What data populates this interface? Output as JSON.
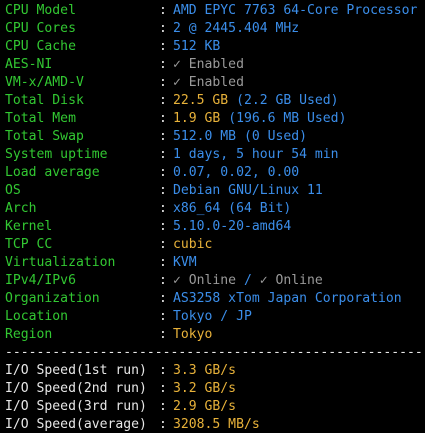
{
  "colors": {
    "background": "#000000",
    "label": "#32c832",
    "separator": "#e8e8e8",
    "value_blue": "#3b8eea",
    "value_gray": "#9a9a9a",
    "value_yellow": "#e8b23a"
  },
  "separator": ":",
  "system_info": [
    {
      "label": "CPU Model",
      "value": "AMD EPYC 7763 64-Core Processor"
    },
    {
      "label": "CPU Cores",
      "value": "2 @ 2445.404 MHz"
    },
    {
      "label": "CPU Cache",
      "value": "512 KB"
    },
    {
      "label": "AES-NI",
      "value": "✓ Enabled"
    },
    {
      "label": "VM-x/AMD-V",
      "value": "✓ Enabled"
    },
    {
      "label": "Total Disk",
      "value": "22.5 GB",
      "value_extra": "(2.2 GB Used)"
    },
    {
      "label": "Total Mem",
      "value": "1.9 GB",
      "value_extra": "(196.6 MB Used)"
    },
    {
      "label": "Total Swap",
      "value": "512.0 MB (0 Used)"
    },
    {
      "label": "System uptime",
      "value": "1 days, 5 hour 54 min"
    },
    {
      "label": "Load average",
      "value": "0.07, 0.02, 0.00"
    },
    {
      "label": "OS",
      "value": "Debian GNU/Linux 11"
    },
    {
      "label": "Arch",
      "value": "x86_64 (64 Bit)"
    },
    {
      "label": "Kernel",
      "value": "5.10.0-20-amd64"
    },
    {
      "label": "TCP CC",
      "value": "cubic"
    },
    {
      "label": "Virtualization",
      "value": "KVM"
    },
    {
      "label": "IPv4/IPv6",
      "value_v4": "✓ Online",
      "value_slash": " / ",
      "value_v6": "✓ Online"
    },
    {
      "label": "Organization",
      "value": "AS3258 xTom Japan Corporation"
    },
    {
      "label": "Location",
      "value": "Tokyo / JP"
    },
    {
      "label": "Region",
      "value": "Tokyo"
    }
  ],
  "divider": "----------------------------------------------------------------------",
  "io_speed": [
    {
      "label": "I/O Speed(1st run)",
      "value": "3.3 GB/s"
    },
    {
      "label": "I/O Speed(2nd run)",
      "value": "3.2 GB/s"
    },
    {
      "label": "I/O Speed(3rd run)",
      "value": "2.9 GB/s"
    },
    {
      "label": "I/O Speed(average)",
      "value": "3208.5 MB/s"
    }
  ]
}
